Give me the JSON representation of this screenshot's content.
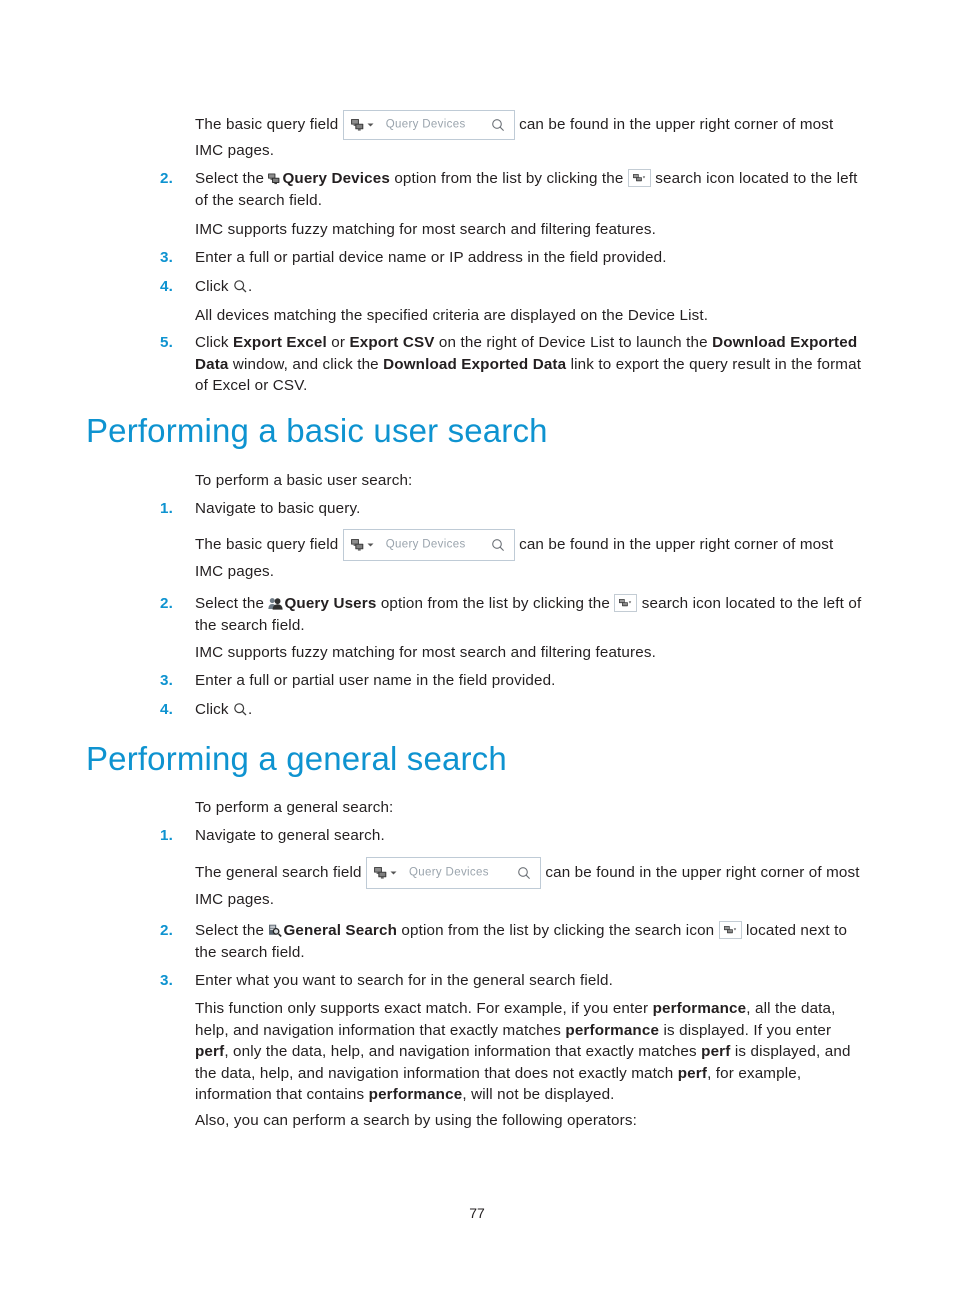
{
  "page": {
    "number": "77",
    "accent_color": "#0e93d0",
    "text_color": "#231f20"
  },
  "search_widget": {
    "placeholder": "Query Devices",
    "device_icon": "device-icon",
    "dropdown_icon": "chevron-down-icon",
    "magnifier_icon": "magnifier-icon"
  },
  "device_search": {
    "field_note": {
      "lead": "The basic query field",
      "tail": "can be found in the upper right corner of most IMC pages."
    },
    "steps": [
      {
        "num": "2.",
        "parts": {
          "p1": "Select the ",
          "bold1": "Query Devices",
          "p2": " option from the list by clicking the ",
          "p3": " search icon located to the left of the search field."
        },
        "note": "IMC supports fuzzy matching for most search and filtering features."
      },
      {
        "num": "3.",
        "text": "Enter a full or partial device name or IP address in the field provided."
      },
      {
        "num": "4.",
        "click_label": "Click",
        "click_tail": ".",
        "note": "All devices matching the specified criteria are displayed on the Device List."
      },
      {
        "num": "5.",
        "parts": {
          "p1": "Click ",
          "bold1": "Export Excel",
          "p2": " or ",
          "bold2": "Export CSV",
          "p3": " on the right of Device List to launch the ",
          "bold3": "Download Exported Data",
          "p4": " window, and click the ",
          "bold4": "Download Exported Data",
          "p5": " link to export the query result in the format of Excel or CSV."
        }
      }
    ]
  },
  "user_search": {
    "heading": "Performing a basic user search",
    "intro": "To perform a basic user search:",
    "steps": [
      {
        "num": "1.",
        "text": "Navigate to basic query."
      },
      {
        "num": "2.",
        "parts": {
          "p1": "Select the ",
          "bold1": "Query Users",
          "p2": " option from the list by clicking the ",
          "p3": " search icon located to the left of the search field."
        },
        "note": "IMC supports fuzzy matching for most search and filtering features."
      },
      {
        "num": "3.",
        "text": "Enter a full or partial user name in the field provided."
      },
      {
        "num": "4.",
        "click_label": "Click",
        "click_tail": "."
      }
    ],
    "field_note": {
      "lead": "The basic query field",
      "tail": "can be found in the upper right corner of most IMC pages."
    },
    "users_icon": "users-icon"
  },
  "general_search": {
    "heading": "Performing a general search",
    "intro": "To perform a general search:",
    "field_note": {
      "lead": "The general search field",
      "tail": "can be found in the upper right corner of most IMC pages."
    },
    "steps": [
      {
        "num": "1.",
        "text": "Navigate to general search."
      },
      {
        "num": "2.",
        "parts": {
          "p1": "Select the ",
          "bold1": "General Search",
          "p2": " option from the list by clicking the search icon ",
          "p3": " located next to the search field."
        }
      },
      {
        "num": "3.",
        "text": "Enter what you want to search for in the general search field.",
        "note_parts": {
          "p1": "This function only supports exact match. For example, if you enter ",
          "bold1": "performance",
          "p2": ", all the data, help, and navigation information that exactly matches ",
          "bold2": "performance",
          "p3": " is displayed. If you enter ",
          "bold3": "perf",
          "p4": ", only the data, help, and navigation information that exactly matches ",
          "bold4": "perf",
          "p5": " is displayed, and the data, help, and navigation information that does not exactly match ",
          "bold5": "perf",
          "p6": ", for example, information that contains ",
          "bold6": "performance",
          "p7": ", will not be displayed."
        },
        "note2": "Also, you can perform a search by using the following operators:"
      }
    ],
    "doc_search_icon": "document-search-icon"
  }
}
